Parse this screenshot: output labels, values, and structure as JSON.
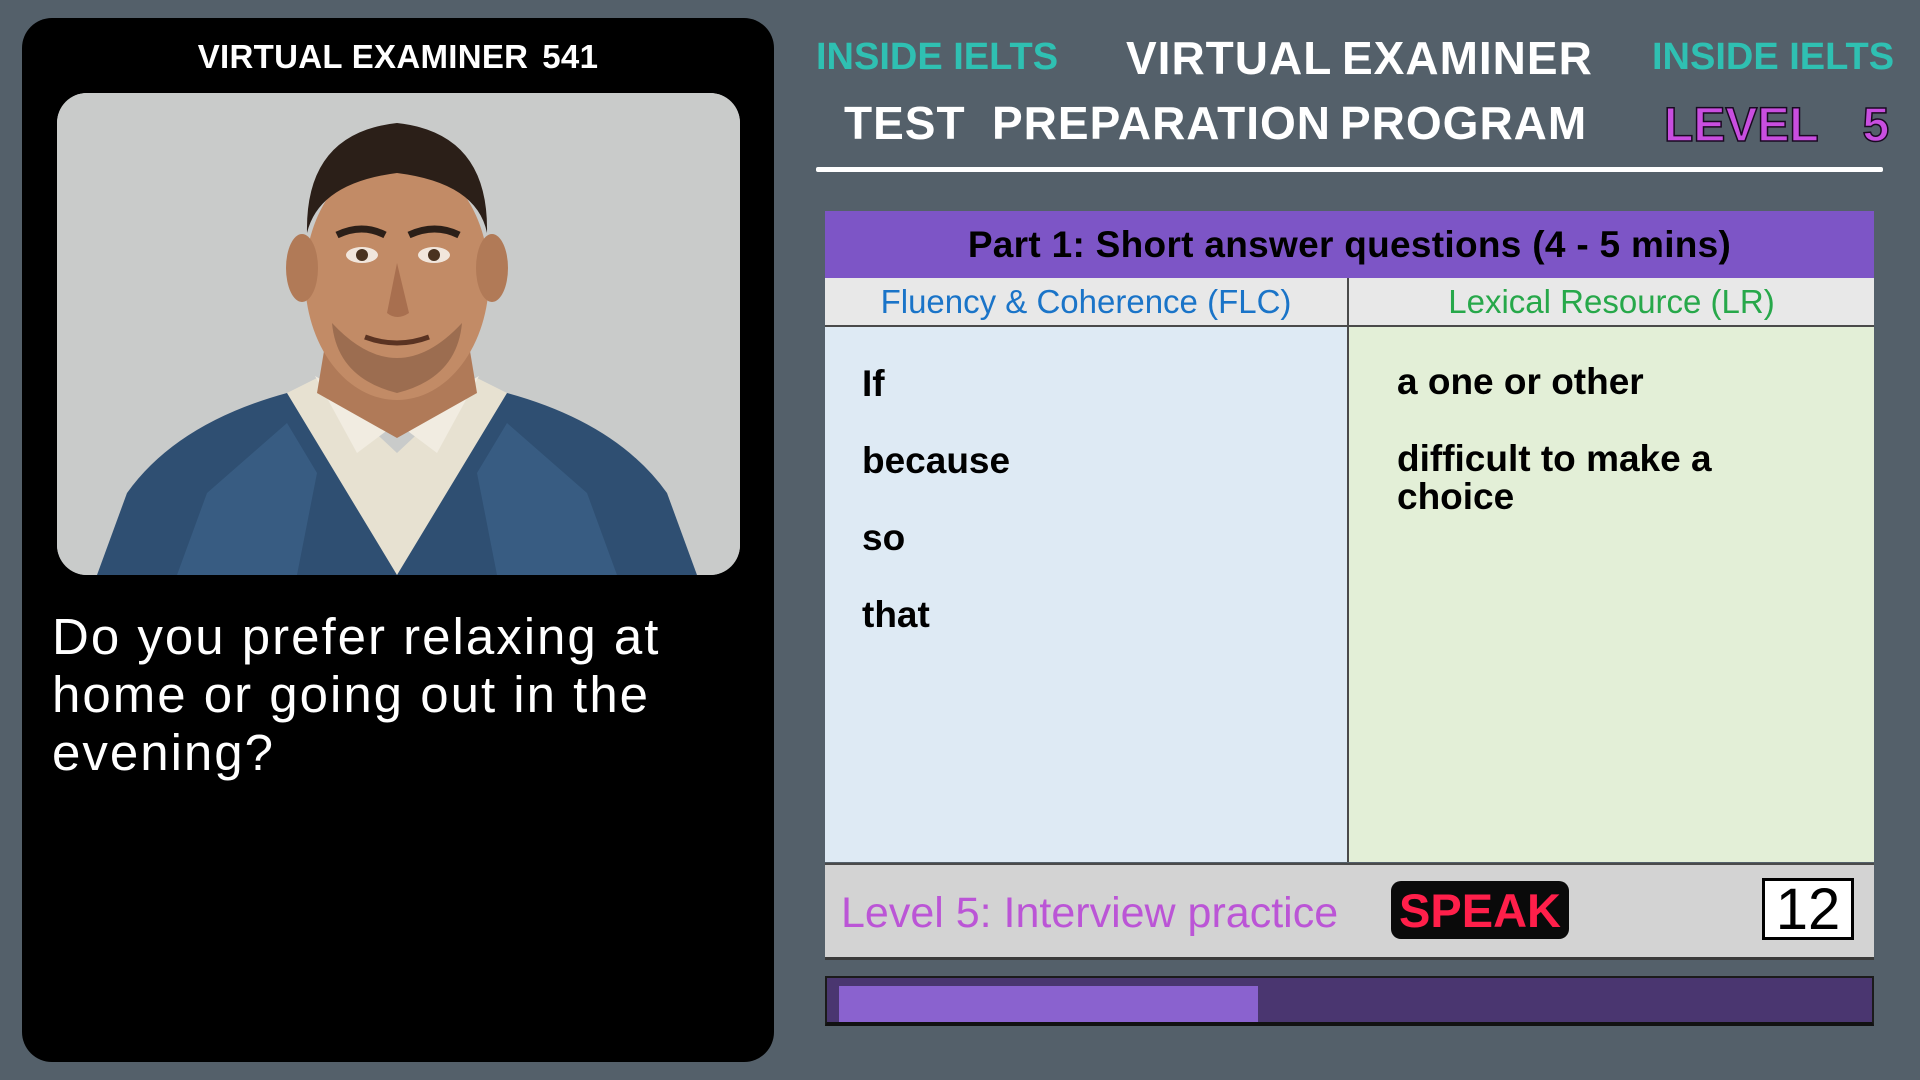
{
  "examiner": {
    "title": "VIRTUAL EXAMINER",
    "number": "541",
    "question": "Do you prefer relaxing at home or going out in the evening?"
  },
  "header": {
    "brand_left": "INSIDE IELTS",
    "brand_right": "INSIDE IELTS",
    "title_words": [
      "VIRTUAL",
      "EXAMINER"
    ],
    "subtitle_words": [
      "TEST",
      "PREPARATION",
      "PROGRAM"
    ],
    "level_label": "LEVEL",
    "level_number": "5"
  },
  "table": {
    "part_title": "Part 1: Short answer questions  (4 - 5 mins)",
    "flc_header": "Fluency & Coherence  (FLC)",
    "lr_header": "Lexical Resource  (LR)",
    "flc_words": [
      "If",
      "because",
      "so",
      "that"
    ],
    "lr_items": [
      "a one or other",
      "difficult to make a choice"
    ]
  },
  "footer": {
    "mode_label": "Level 5: Interview practice",
    "speak_label": "SPEAK",
    "counter": "12"
  },
  "progress": {
    "fraction": 0.41
  },
  "colors": {
    "background": "#54606a",
    "brand_teal": "#2fc0b2",
    "level_purple": "#c94ee0",
    "part_bar": "#7d55c6",
    "flc_blue": "#1a74c8",
    "lr_green": "#27a84a",
    "speak_red": "#ff1f4a",
    "progress_fill": "#8a62cf"
  }
}
